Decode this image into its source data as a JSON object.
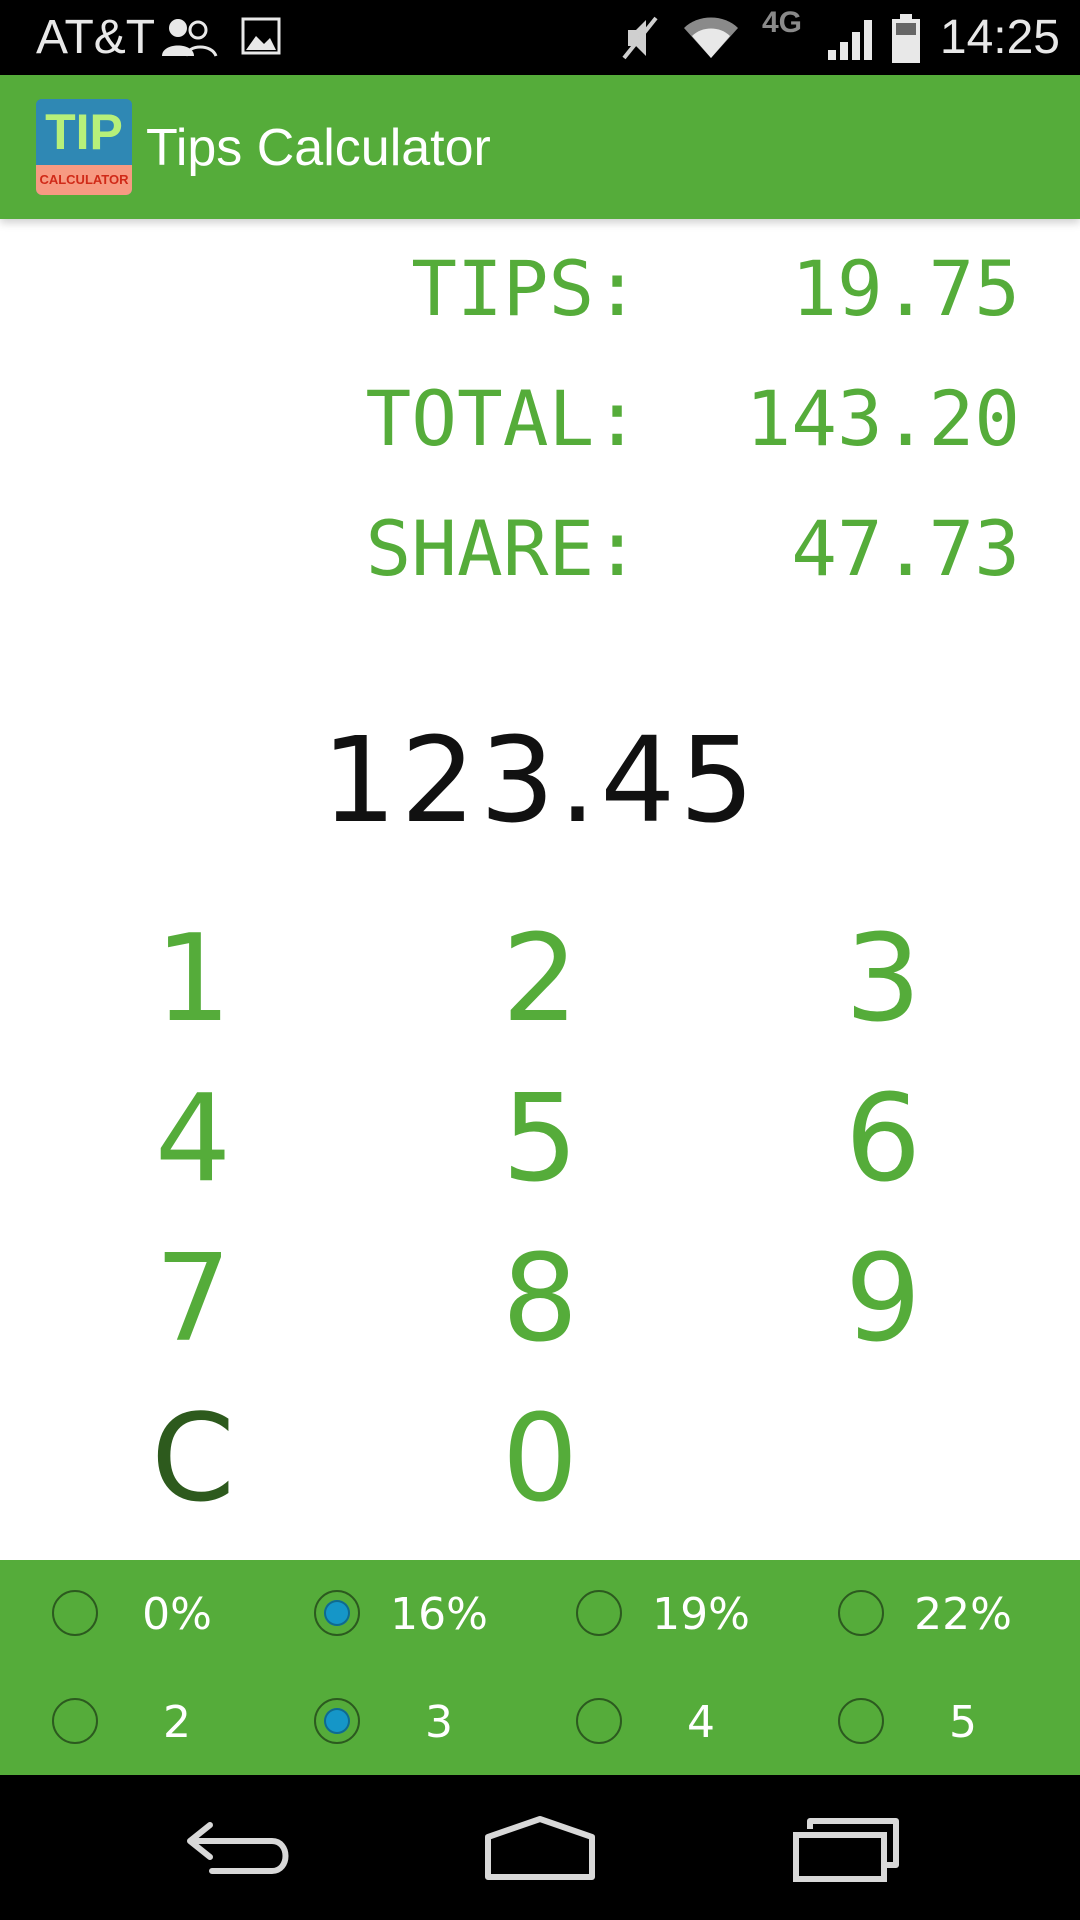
{
  "status_bar": {
    "carrier": "AT&T",
    "network": "4G",
    "time": "14:25",
    "icons": [
      "people-icon",
      "image-icon",
      "mute-icon",
      "wifi-icon",
      "signal-icon",
      "battery-icon"
    ]
  },
  "app_bar": {
    "title": "Tips Calculator",
    "logo_top": "TIP",
    "logo_bottom": "CALCULATOR"
  },
  "results": {
    "tips_label": "TIPS:",
    "tips_value": "19.75",
    "total_label": "TOTAL:",
    "total_value": "143.20",
    "share_label": "SHARE:",
    "share_value": "47.73"
  },
  "amount": "123.45",
  "keypad": {
    "keys": [
      "1",
      "2",
      "3",
      "4",
      "5",
      "6",
      "7",
      "8",
      "9",
      "C",
      "0"
    ]
  },
  "tip_options": {
    "labels": [
      "0%",
      "16%",
      "19%",
      "22%"
    ],
    "selected": "16%"
  },
  "people_options": {
    "labels": [
      "2",
      "3",
      "4",
      "5"
    ],
    "selected": "3"
  },
  "colors": {
    "primary": "#55ac3a",
    "clear_key": "#2d5a1d",
    "radio_selected": "#1596c8",
    "amount_text": "#111111"
  },
  "nav_icons": [
    "back-icon",
    "home-icon",
    "recents-icon"
  ]
}
